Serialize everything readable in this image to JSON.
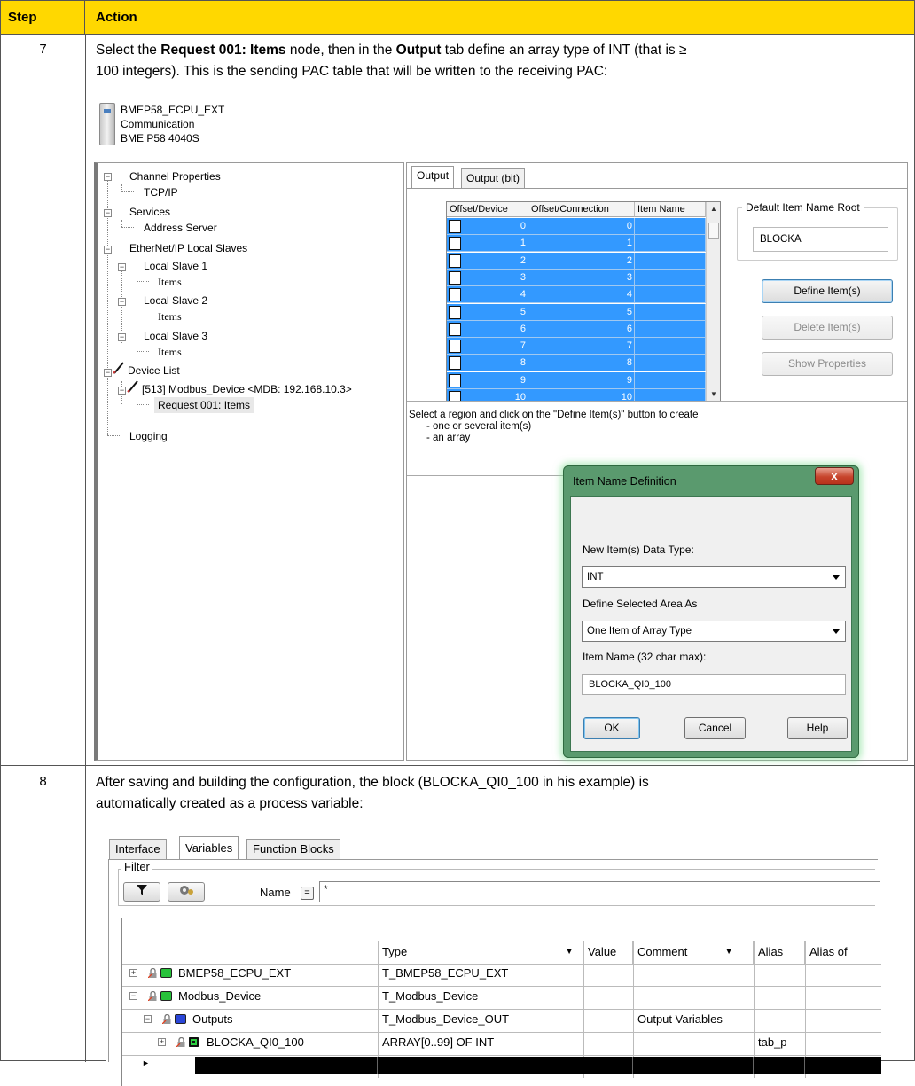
{
  "table": {
    "header_step": "Step",
    "header_action": "Action"
  },
  "step7": {
    "number": "7",
    "text_1": "Select the ",
    "node_name": "Request 001: Items",
    "text_2": " node, then in the ",
    "tab_name": "Output",
    "text_3": " tab define an array type of INT (that is ≥",
    "text_4": "100 integers). This is the sending PAC table that will be written to the receiving PAC:"
  },
  "device": {
    "name": "BMEP58_ECPU_EXT",
    "category": "Communication",
    "model": "BME P58 4040S"
  },
  "tree": {
    "channel_properties": "Channel Properties",
    "tcpip": "TCP/IP",
    "services": "Services",
    "address_server": "Address Server",
    "local_slaves": "EtherNet/IP Local Slaves",
    "local_slave_1": "Local Slave 1",
    "items_1": "Items",
    "local_slave_2": "Local Slave 2",
    "items_2": "Items",
    "local_slave_3": "Local Slave 3",
    "items_3": "Items",
    "device_list": "Device List",
    "modbus_device": "[513] Modbus_Device <MDB: 192.168.10.3>",
    "request": "Request 001: Items",
    "logging": "Logging",
    "expander_minus": "−"
  },
  "output_panel": {
    "tab_output": "Output",
    "tab_output_bit": "Output (bit)",
    "col_offset_device": "Offset/Device",
    "col_offset_connection": "Offset/Connection",
    "col_item_name": "Item Name",
    "rows": [
      {
        "device": "0",
        "connection": "0"
      },
      {
        "device": "1",
        "connection": "1"
      },
      {
        "device": "2",
        "connection": "2"
      },
      {
        "device": "3",
        "connection": "3"
      },
      {
        "device": "4",
        "connection": "4"
      },
      {
        "device": "5",
        "connection": "5"
      },
      {
        "device": "6",
        "connection": "6"
      },
      {
        "device": "7",
        "connection": "7"
      },
      {
        "device": "8",
        "connection": "8"
      },
      {
        "device": "9",
        "connection": "9"
      },
      {
        "device": "10",
        "connection": "10"
      }
    ],
    "default_root_label": "Default Item Name Root",
    "default_root_value": "BLOCKA",
    "define_items": "Define Item(s)",
    "delete_items": "Delete Item(s)",
    "show_properties": "Show Properties",
    "hint_line1": "Select a region and click on the \"Define Item(s)\" button to create",
    "hint_line2": "- one or several item(s)",
    "hint_line3": "- an array"
  },
  "dialog": {
    "title": "Item Name Definition",
    "close": "x",
    "data_type_label": "New Item(s) Data Type:",
    "data_type_value": "INT",
    "define_area_label": "Define Selected Area As",
    "define_area_value": "One Item of Array Type",
    "item_name_label": "Item Name (32 char max):",
    "item_name_value": "BLOCKA_QI0_100",
    "ok": "OK",
    "cancel": "Cancel",
    "help": "Help"
  },
  "step8": {
    "number": "8",
    "text_1": "After saving and building the configuration, the block (BLOCKA_QI0_100 in his example) is",
    "text_2": "automatically created as a process variable:"
  },
  "variables": {
    "tab_interface": "Interface",
    "tab_variables": "Variables",
    "tab_function_blocks": "Function Blocks",
    "filter_label": "Filter",
    "name_label": "Name",
    "eq_button": "=",
    "name_value": "*",
    "col_type": "Type",
    "col_value": "Value",
    "col_comment": "Comment",
    "col_alias": "Alias",
    "col_alias_of": "Alias of",
    "rows": [
      {
        "name": "BMEP58_ECPU_EXT",
        "type": "T_BMEP58_ECPU_EXT",
        "comment": "",
        "alias": "",
        "expander": "+"
      },
      {
        "name": "Modbus_Device",
        "type": "T_Modbus_Device",
        "comment": "",
        "alias": "",
        "expander": "−"
      },
      {
        "name": "Outputs",
        "type": "T_Modbus_Device_OUT",
        "comment": "Output Variables",
        "alias": "",
        "expander": "−"
      },
      {
        "name": "BLOCKA_QI0_100",
        "type": "ARRAY[0..99] OF INT",
        "comment": "",
        "alias": "tab_p",
        "expander": "+"
      }
    ],
    "colors": {
      "green_cube": "#27c23a",
      "blue_cube": "#2a46d8",
      "selection": "#3399ff",
      "header_bar": "#ffd800"
    }
  }
}
